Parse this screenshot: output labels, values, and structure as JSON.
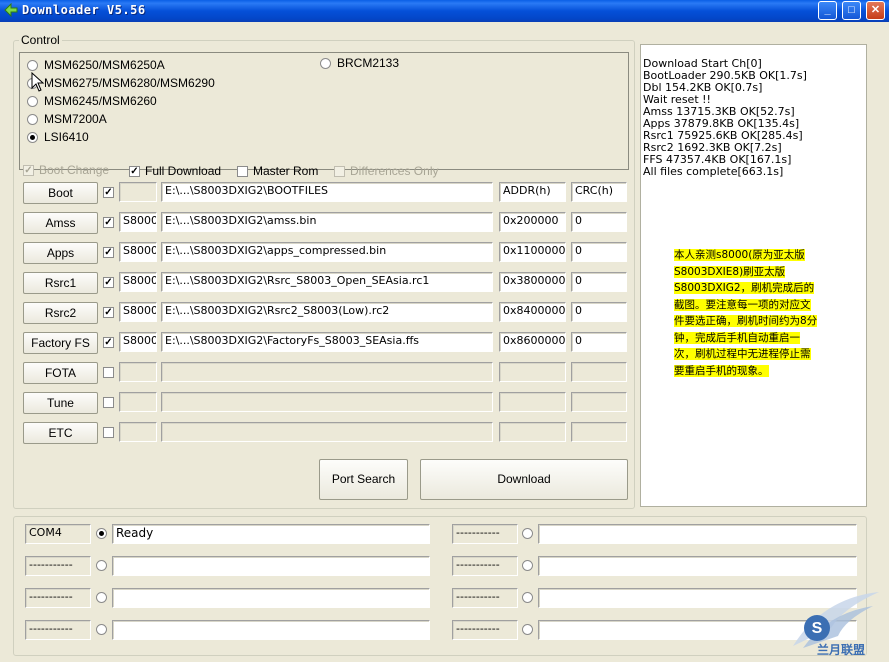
{
  "window": {
    "title": "Downloader V5.56"
  },
  "control": {
    "label": "Control",
    "radios": [
      {
        "label": "MSM6250/MSM6250A",
        "checked": false
      },
      {
        "label": "MSM6275/MSM6280/MSM6290",
        "checked": false
      },
      {
        "label": "MSM6245/MSM6260",
        "checked": false
      },
      {
        "label": "MSM7200A",
        "checked": false
      },
      {
        "label": "LSI6410",
        "checked": true
      },
      {
        "label": "BRCM2133",
        "checked": false
      }
    ],
    "options": {
      "boot_change": "Boot Change",
      "full_download": "Full Download",
      "master_rom": "Master Rom",
      "differences_only": "Differences Only"
    },
    "headers": {
      "addr": "ADDR(h)",
      "crc": "CRC(h)"
    },
    "rows": [
      {
        "button": "Boot",
        "checked": true,
        "model": "",
        "path": "E:\\...\\S8003DXIG2\\BOOTFILES",
        "addr": "ADDR(h)",
        "crc": "CRC(h)"
      },
      {
        "button": "Amss",
        "checked": true,
        "model": "S8000",
        "path": "E:\\...\\S8003DXIG2\\amss.bin",
        "addr": "0x200000",
        "crc": "0"
      },
      {
        "button": "Apps",
        "checked": true,
        "model": "S8000",
        "path": "E:\\...\\S8003DXIG2\\apps_compressed.bin",
        "addr": "0x1100000",
        "crc": "0"
      },
      {
        "button": "Rsrc1",
        "checked": true,
        "model": "S8000",
        "path": "E:\\...\\S8003DXIG2\\Rsrc_S8003_Open_SEAsia.rc1",
        "addr": "0x3800000",
        "crc": "0"
      },
      {
        "button": "Rsrc2",
        "checked": true,
        "model": "S8000",
        "path": "E:\\...\\S8003DXIG2\\Rsrc2_S8003(Low).rc2",
        "addr": "0x8400000",
        "crc": "0"
      },
      {
        "button": "Factory FS",
        "checked": true,
        "model": "S8000",
        "path": "E:\\...\\S8003DXIG2\\FactoryFs_S8003_SEAsia.ffs",
        "addr": "0x8600000",
        "crc": "0"
      },
      {
        "button": "FOTA",
        "checked": false,
        "model": "",
        "path": "",
        "addr": "",
        "crc": ""
      },
      {
        "button": "Tune",
        "checked": false,
        "model": "",
        "path": "",
        "addr": "",
        "crc": ""
      },
      {
        "button": "ETC",
        "checked": false,
        "model": "",
        "path": "",
        "addr": "",
        "crc": ""
      }
    ],
    "port_search": "Port Search",
    "download": "Download"
  },
  "log": {
    "lines": "Download Start Ch[0]\nBootLoader 290.5KB OK[1.7s]\nDbl 154.2KB OK[0.7s]\nWait reset !!\nAmss 13715.3KB OK[52.7s]\nApps 37879.8KB OK[135.4s]\nRsrc1 75925.6KB OK[285.4s]\nRsrc2 1692.3KB OK[7.2s]\nFFS 47357.4KB OK[167.1s]\nAll files complete[663.1s]",
    "note": "本人亲测s8000(原为亚太版S8003DXIE8)刷亚太版S8003DXIG2，刷机完成后的截图。要注意每一项的对应文件要选正确，刷机时间约为8分钟，完成后手机自动重启一次，刷机过程中无进程停止需要重启手机的现象。",
    "note_color": "#ffff00"
  },
  "ports": [
    {
      "name": "COM4",
      "status": "Ready",
      "selected": true
    },
    {
      "name": "-----------",
      "status": "",
      "selected": false
    },
    {
      "name": "-----------",
      "status": "",
      "selected": false
    },
    {
      "name": "-----------",
      "status": "",
      "selected": false
    },
    {
      "name": "-----------",
      "status": "",
      "selected": false
    },
    {
      "name": "-----------",
      "status": "",
      "selected": false
    },
    {
      "name": "-----------",
      "status": "",
      "selected": false
    },
    {
      "name": "-----------",
      "status": "",
      "selected": false
    }
  ],
  "watermark": {
    "text": "兰月联盟"
  }
}
